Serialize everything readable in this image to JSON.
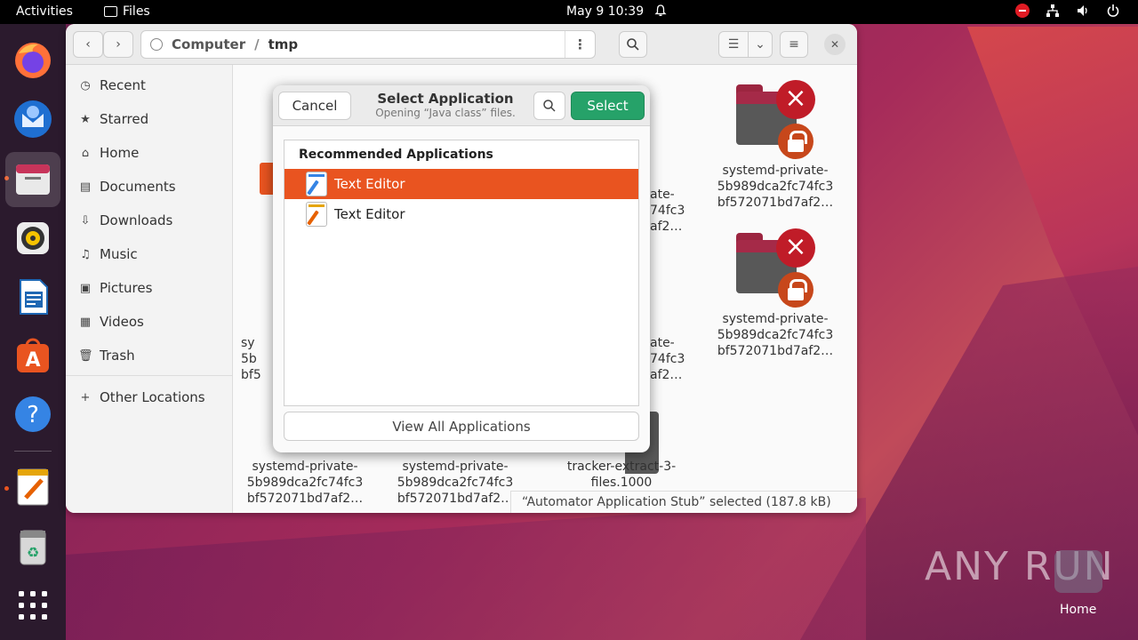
{
  "topbar": {
    "activities": "Activities",
    "app_name": "Files",
    "clock": "May 9  10:39"
  },
  "dock": {
    "items": [
      "firefox",
      "thunderbird",
      "files",
      "rhythmbox",
      "libreoffice-writer",
      "app-center",
      "help",
      "text-editor",
      "trash",
      "show-apps"
    ]
  },
  "files": {
    "path": [
      "Computer",
      "/",
      "tmp"
    ],
    "sidebar": [
      {
        "label": "Recent",
        "icon": "clock-icon"
      },
      {
        "label": "Starred",
        "icon": "star-icon"
      },
      {
        "label": "Home",
        "icon": "home-icon"
      },
      {
        "label": "Documents",
        "icon": "document-icon"
      },
      {
        "label": "Downloads",
        "icon": "download-icon"
      },
      {
        "label": "Music",
        "icon": "music-icon"
      },
      {
        "label": "Pictures",
        "icon": "picture-icon"
      },
      {
        "label": "Videos",
        "icon": "video-icon"
      },
      {
        "label": "Trash",
        "icon": "trash-icon"
      },
      {
        "label": "Other Locations",
        "icon": "plus-icon"
      }
    ],
    "grid_items": [
      {
        "line1": "systemd-private-",
        "line2": "5b989dca2fc74fc3",
        "line3": "bf572071bd7af2…"
      },
      {
        "line1": "systemd-private-",
        "line2": "5b989dca2fc74fc3",
        "line3": "bf572071bd7af2…"
      },
      {
        "line1": "systemd-private-",
        "line2": "5b989dca2fc74fc3",
        "line3": "bf572071bd7af2…"
      },
      {
        "line1": "systemd-private-",
        "line2": "5b989dca2fc74fc3",
        "line3": "bf572071bd7af2…"
      },
      {
        "line1": "tracker-extract-3-",
        "line2": "files.1000",
        "line3": ""
      }
    ],
    "partial_labels": {
      "row2_left": [
        "sy",
        "5b",
        "bf5"
      ],
      "row_mid_top": [
        "ate-",
        "74fc3",
        "af2…"
      ],
      "row_mid_mid": [
        "ate-",
        "74fc3",
        "af2…"
      ]
    },
    "status": "“Automator Application Stub” selected (187.8 kB)"
  },
  "dialog": {
    "cancel": "Cancel",
    "title": "Select Application",
    "subtitle": "Opening “Java class” files.",
    "select": "Select",
    "section": "Recommended Applications",
    "apps": [
      "Text Editor",
      "Text Editor"
    ],
    "view_all": "View All Applications"
  },
  "desktop": {
    "watermark": "ANY RUN",
    "home_label": "Home"
  },
  "colors": {
    "accent": "#e95420",
    "select_button": "#26a269",
    "badge_red": "#c01c28"
  }
}
